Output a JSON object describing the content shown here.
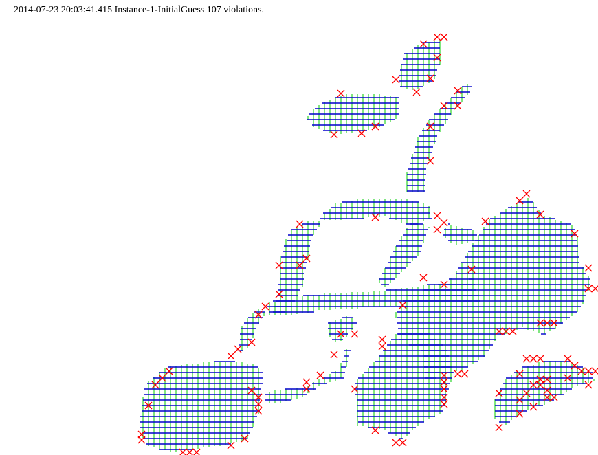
{
  "header": {
    "status_line": "2014-07-23 20:03:41.415 Instance-1-InitialGuess 107 violations."
  },
  "colors": {
    "background": "#ffffff",
    "horizontal_segments": "#0000cc",
    "vertical_segments": "#00cc00",
    "violation_marker": "#ff0000",
    "text": "#000000"
  },
  "legend_semantics": {
    "horizontal_segments": "blue-line",
    "vertical_segments": "green-line",
    "violations": "red-x-marker"
  }
}
